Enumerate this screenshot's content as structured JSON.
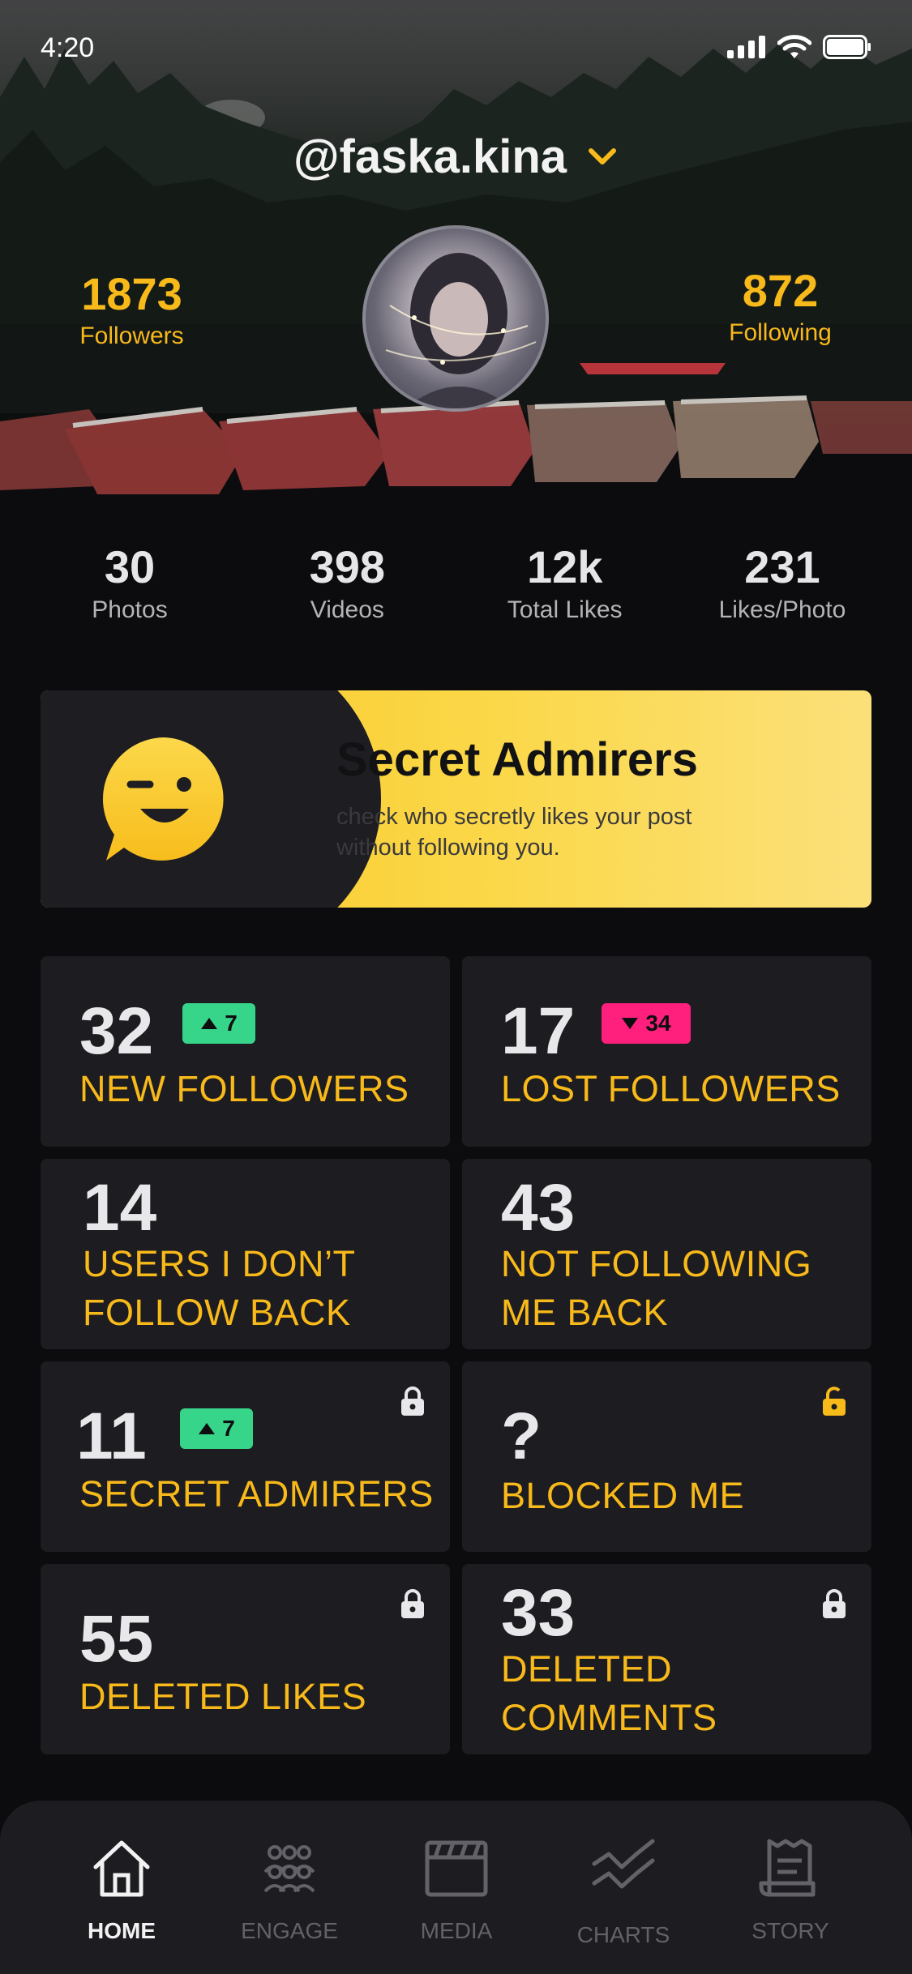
{
  "status": {
    "time": "4:20"
  },
  "profile": {
    "username": "@faska.kina",
    "followers": {
      "value": "1873",
      "label": "Followers"
    },
    "following": {
      "value": "872",
      "label": "Following"
    }
  },
  "counts": [
    {
      "value": "30",
      "label": "Photos"
    },
    {
      "value": "398",
      "label": "Videos"
    },
    {
      "value": "12k",
      "label": "Total Likes"
    },
    {
      "value": "231",
      "label": "Likes/Photo"
    }
  ],
  "banner": {
    "title": "Secret Admirers",
    "desc_line1": "check who secretly likes your post",
    "desc_line2": "without following you."
  },
  "tiles": {
    "new_followers": {
      "value": "32",
      "badge": "7",
      "line1": "NEW FOLLOWERS"
    },
    "lost_followers": {
      "value": "17",
      "badge": "34",
      "line1": "LOST FOLLOWERS"
    },
    "dont_follow_back": {
      "value": "14",
      "line1": "USERS I DON’T",
      "line2": "FOLLOW BACK"
    },
    "not_following_back": {
      "value": "43",
      "line1": "NOT FOLLOWING",
      "line2": "ME BACK"
    },
    "secret_admirers": {
      "value": "11",
      "badge": "7",
      "line1": "SECRET ADMIRERS"
    },
    "blocked_me": {
      "value": "?",
      "line1": "BLOCKED ME"
    },
    "deleted_likes": {
      "value": "55",
      "line1": "DELETED LIKES"
    },
    "deleted_comments": {
      "value": "33",
      "line1": "DELETED",
      "line2": "COMMENTS"
    }
  },
  "nav": {
    "home": "HOME",
    "engage": "ENGAGE",
    "media": "MEDIA",
    "charts": "CHARTS",
    "story": "STORY"
  },
  "colors": {
    "accent": "#f8b91a",
    "up": "#37d58a",
    "down": "#ff1f7c",
    "tile": "#1c1c21",
    "background": "#0c0c0e"
  }
}
